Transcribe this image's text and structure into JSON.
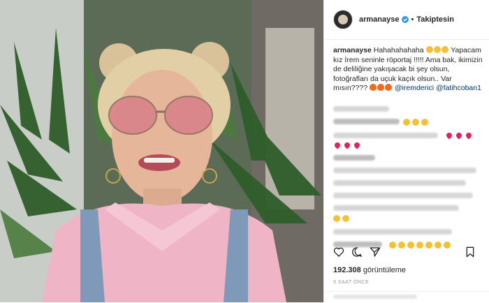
{
  "post": {
    "username": "armanayse",
    "follow_label": "Takiptesin",
    "separator": "•"
  },
  "caption": {
    "username": "armanayse",
    "text_part1": "Hahahahahaha",
    "text_part2": "Yapacam kız İrem seninle röportaj !!!!! Ama bak, ikimizin de deliliğine yakışacak bi şey olsun, fotoğrafları da uçuk kaçık olsun.. Var mısın????",
    "mention1": "@iremderici",
    "mention2": "@fatihcoban1"
  },
  "stats": {
    "views_count": "192.308",
    "views_label": "görüntüleme",
    "time_ago": "9 SAAT ÖNCE"
  },
  "colors": {
    "accent": "#3897f0",
    "link": "#003569",
    "heart": "#e0245e",
    "emoji_yellow": "#f3c037"
  },
  "icons": {
    "like": "heart-icon",
    "comment": "comment-icon",
    "share": "share-icon",
    "save": "bookmark-icon",
    "verified": "verified-badge-icon"
  }
}
